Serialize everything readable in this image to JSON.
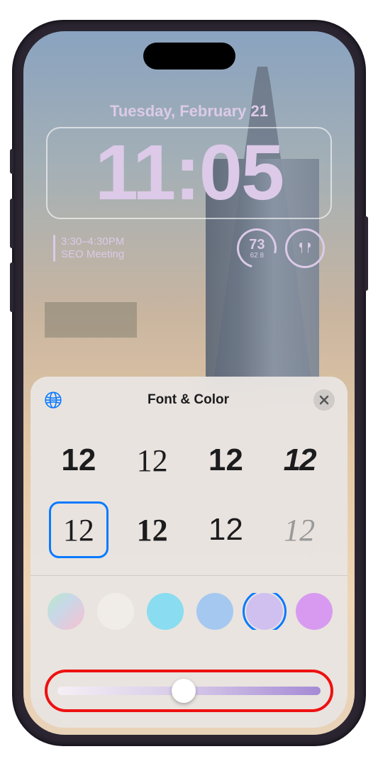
{
  "lockscreen": {
    "date": "Tuesday, February 21",
    "time": "11:05",
    "calendar": {
      "time_range": "3:30–4:30PM",
      "event": "SEO Meeting"
    },
    "weather": {
      "temp": "73",
      "low": "62",
      "high": "8"
    }
  },
  "panel": {
    "title": "Font & Color",
    "fonts": [
      "12",
      "12",
      "12",
      "12",
      "12",
      "12",
      "12",
      "12"
    ],
    "selected_font_index": 4,
    "colors": [
      {
        "value": "linear-gradient(135deg,#b8e8c8 0%,#c8d8e8 40%,#e8c8d8 80%)",
        "selected": false
      },
      {
        "value": "#f0ede8",
        "selected": false
      },
      {
        "value": "#8adcf0",
        "selected": false
      },
      {
        "value": "#a5c8f0",
        "selected": false
      },
      {
        "value": "#d0c0f0",
        "selected": true
      },
      {
        "value": "#d89af0",
        "selected": false
      },
      {
        "value": "#f0b8c8",
        "selected": false
      }
    ],
    "slider_value": 0.48
  },
  "callout_color": "#e11"
}
